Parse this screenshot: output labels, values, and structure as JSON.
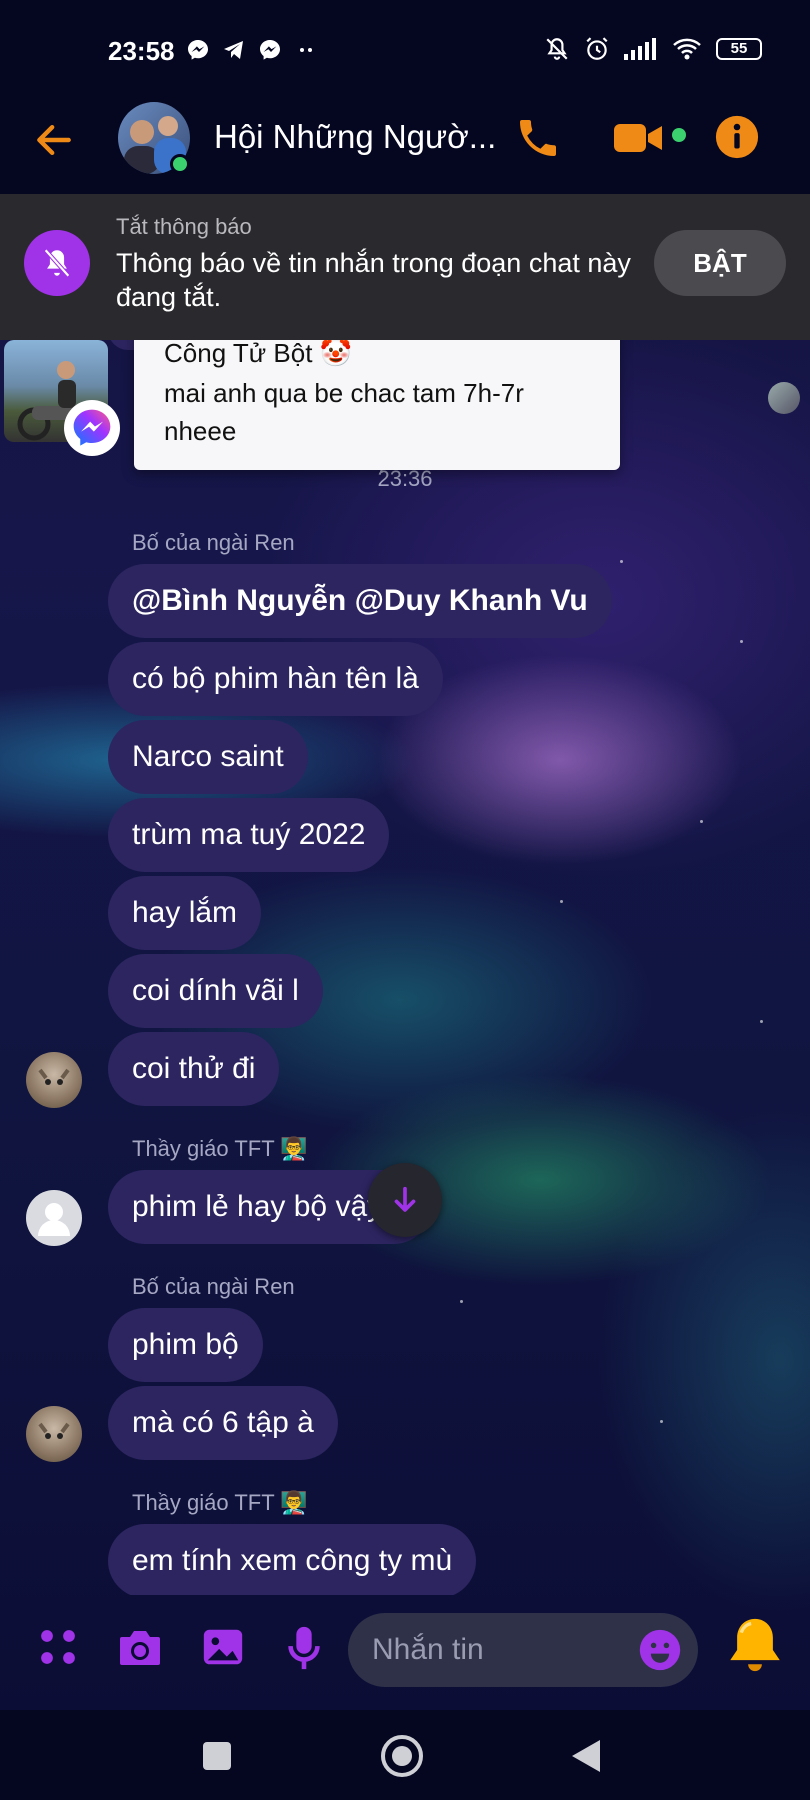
{
  "status_bar": {
    "time": "23:58",
    "battery": "55"
  },
  "header": {
    "title": "Hội Những Ngườ...",
    "online": true
  },
  "banner": {
    "label": "Tắt thông báo",
    "text": "Thông báo về tin nhắn trong đoạn chat này đang tắt.",
    "button": "BẬT"
  },
  "popup": {
    "sender": "Công Tử Bột 🤡",
    "text": "mai anh qua be chac tam 7h-7r nheee"
  },
  "chat": {
    "timestamp": "23:36",
    "groups": [
      {
        "sender": "Bố của ngài Ren",
        "messages": [
          "@Bình Nguyễn @Duy Khanh Vu",
          "có bộ phim hàn tên là",
          "Narco saint",
          "trùm ma tuý 2022",
          "hay lắm",
          "coi dính vãi l",
          "coi thử đi"
        ]
      },
      {
        "sender": "Thầy giáo TFT 👨‍🏫",
        "messages": [
          "phim lẻ hay bộ vậy a"
        ]
      },
      {
        "sender": "Bố của ngài Ren",
        "messages": [
          "phim bộ",
          "mà có 6 tập à"
        ]
      },
      {
        "sender": "Thầy giáo TFT 👨‍🏫",
        "messages": [
          "em tính xem công ty mù"
        ]
      }
    ]
  },
  "composer": {
    "placeholder": "Nhắn tin"
  },
  "colors": {
    "accent_orange": "#f08a16",
    "accent_purple": "#a033e8",
    "bubble": "#2c2560"
  }
}
